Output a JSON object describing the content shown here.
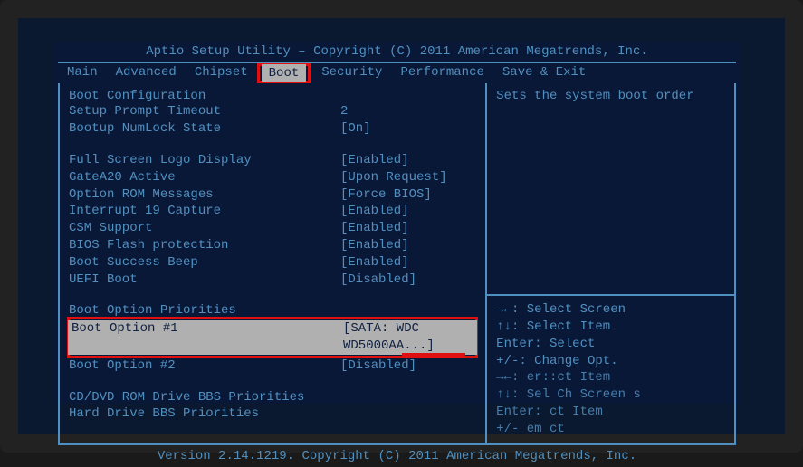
{
  "header": "Aptio Setup Utility – Copyright (C) 2011 American Megatrends, Inc.",
  "tabs": [
    "Main",
    "Advanced",
    "Chipset",
    "Boot",
    "Security",
    "Performance",
    "Save & Exit"
  ],
  "active_tab": "Boot",
  "sections": {
    "boot_config_title": "Boot Configuration",
    "setup_prompt_timeout": {
      "label": "Setup Prompt Timeout",
      "value": "2"
    },
    "bootup_numlock": {
      "label": "Bootup NumLock State",
      "value": "[On]"
    },
    "full_screen_logo": {
      "label": "Full Screen Logo Display",
      "value": "[Enabled]"
    },
    "gatea20": {
      "label": "GateA20 Active",
      "value": "[Upon Request]"
    },
    "option_rom": {
      "label": "Option ROM Messages",
      "value": "[Force BIOS]"
    },
    "interrupt19": {
      "label": "Interrupt 19 Capture",
      "value": "[Enabled]"
    },
    "csm": {
      "label": "CSM Support",
      "value": "[Enabled]"
    },
    "bios_flash": {
      "label": "BIOS Flash protection",
      "value": "[Enabled]"
    },
    "boot_beep": {
      "label": "Boot Success Beep",
      "value": "[Enabled]"
    },
    "uefi_boot": {
      "label": "UEFI Boot",
      "value": "[Disabled]"
    },
    "priorities_title": "Boot Option Priorities",
    "boot_option_1": {
      "label": "Boot Option #1",
      "value": "[SATA: WDC WD5000AA...]"
    },
    "boot_option_2": {
      "label": "Boot Option #2",
      "value": "[Disabled]"
    },
    "cddvd_bbs": "CD/DVD ROM Drive BBS Priorities",
    "hdd_bbs": "Hard Drive BBS Priorities"
  },
  "help_text": "Sets the system boot order",
  "keys": {
    "k1": "→←: Select Screen",
    "k2": "↑↓: Select Item",
    "k3": "Enter: Select",
    "k4": "+/-: Change Opt.",
    "k5": "→←:  er::ct Item",
    "k6": "↑↓: Sel Ch  Screen   s",
    "k7": "Enter:   ct Item",
    "k8": "+/-  em  ct"
  },
  "footer": "Version 2.14.1219. Copyright (C) 2011 American Megatrends, Inc."
}
